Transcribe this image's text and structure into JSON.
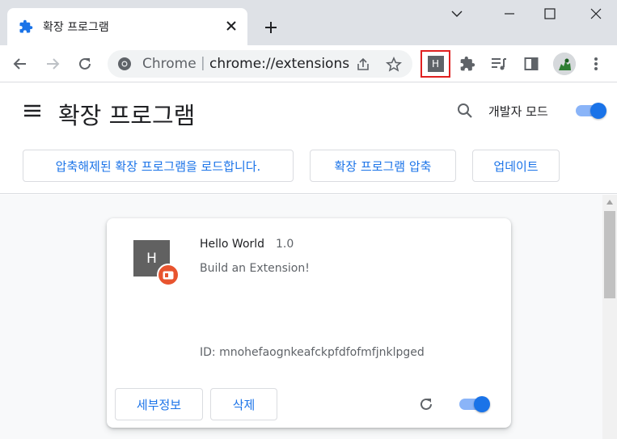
{
  "window": {
    "tab_title": "확장 프로그램",
    "tab_icon": "puzzle-icon",
    "controls": [
      "chevron-down-icon",
      "minimize-icon",
      "maximize-icon",
      "close-icon"
    ]
  },
  "toolbar": {
    "omnibox_site": "Chrome",
    "omnibox_separator": "|",
    "omnibox_url": "chrome://extensions",
    "pinned_extension_letter": "H"
  },
  "page": {
    "title": "확장 프로그램",
    "dev_mode_label": "개발자 모드",
    "dev_mode_on": true,
    "buttons": {
      "load_unpacked": "압축해제된 확장 프로그램을 로드합니다.",
      "pack": "확장 프로그램 압축",
      "update": "업데이트"
    }
  },
  "extension": {
    "icon_letter": "H",
    "name": "Hello World",
    "version": "1.0",
    "description": "Build an Extension!",
    "id_text": "ID: mnohefaognkeafckpfdfofmfjnklpged",
    "details_button": "세부정보",
    "remove_button": "삭제",
    "enabled": true
  },
  "colors": {
    "accent": "#1a73e8",
    "titlebar": "#dee1e6",
    "highlight_box": "#e02020",
    "badge": "#e8542f"
  }
}
